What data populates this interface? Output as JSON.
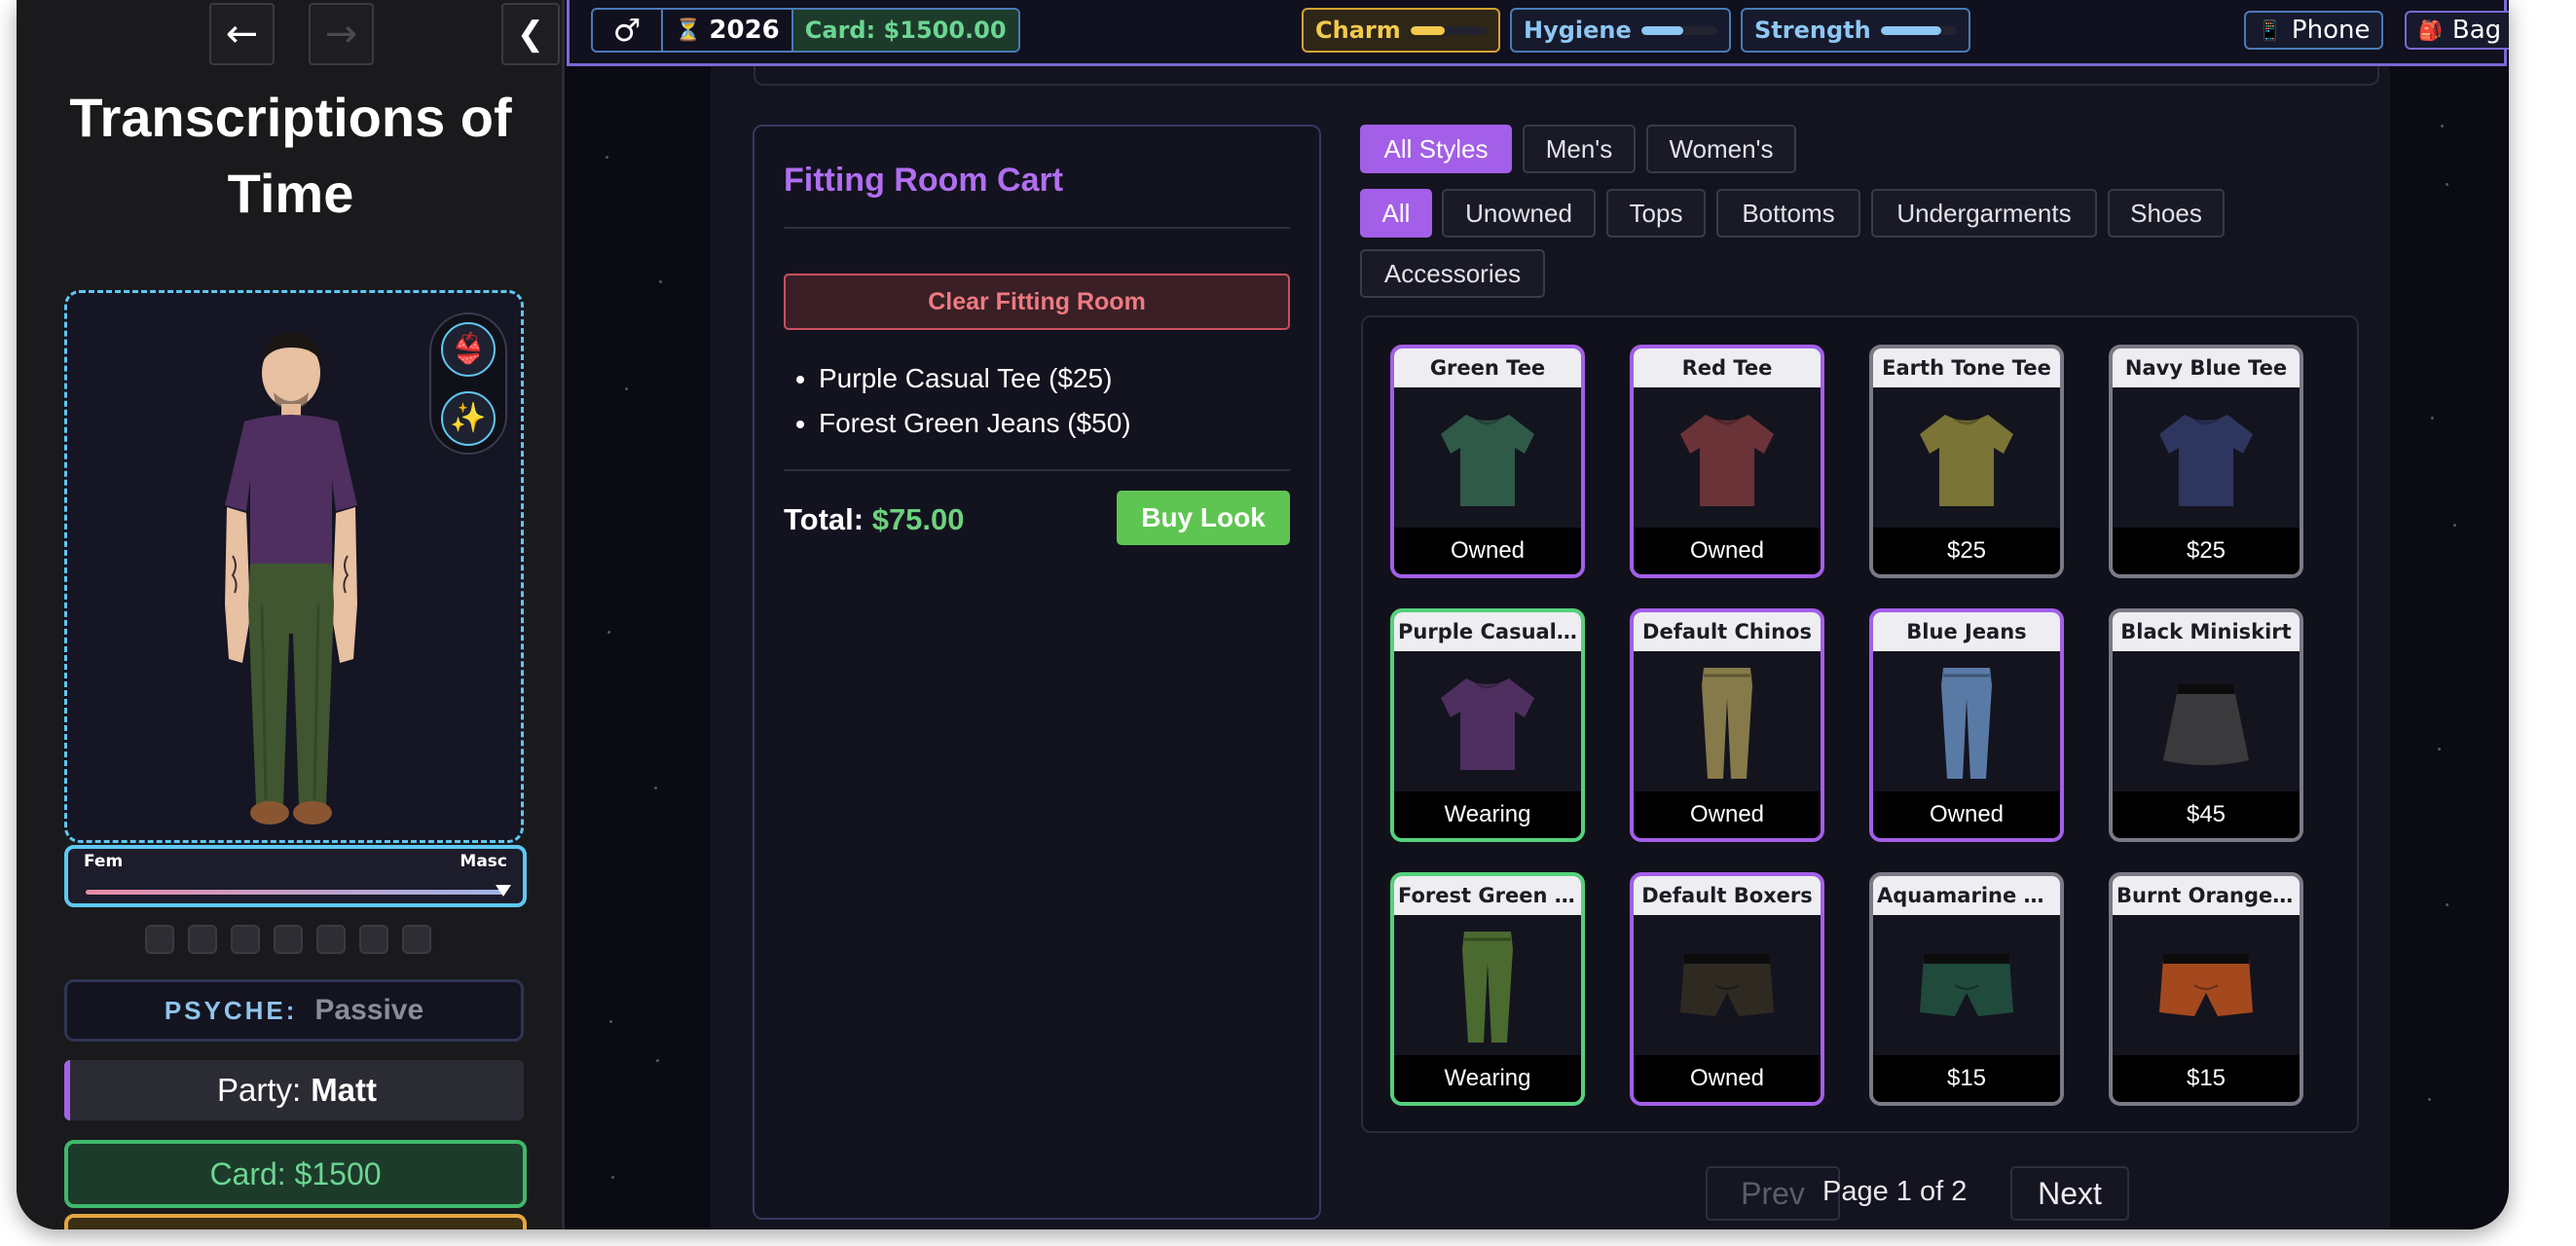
{
  "sidebar": {
    "back_icon": "arrow-left-icon",
    "forward_icon": "arrow-right-icon",
    "collapse_icon": "chevron-left-icon",
    "title": "Transcriptions of Time",
    "tool_buttons": [
      {
        "name": "lingerie-icon",
        "glyph": "👙"
      },
      {
        "name": "sparkles-icon",
        "glyph": "✨"
      }
    ],
    "gender_slider": {
      "left_label": "Fem",
      "right_label": "Masc",
      "value_fraction": 0.97
    },
    "psyche": {
      "label": "PSYCHE:",
      "value": "Passive"
    },
    "party": {
      "label": "Party:",
      "value": "Matt"
    },
    "card": "Card: $1500"
  },
  "topbar": {
    "gender_glyph": "♂",
    "hourglass_glyph": "⏳",
    "year": "2026",
    "card": "Card: $1500.00",
    "stats": [
      {
        "label": "Charm",
        "level": 0.45,
        "color": "#f2c94c",
        "border": "#d4a236",
        "bg": "#2e2616"
      },
      {
        "label": "Hygiene",
        "level": 0.55,
        "color": "#8ec6f4",
        "border": "#4a7ab8",
        "bg": "#161a2c"
      },
      {
        "label": "Strength",
        "level": 0.8,
        "color": "#8ec6f4",
        "border": "#4a7ab8",
        "bg": "#161a2c"
      }
    ],
    "phone_glyph": "📱",
    "phone": "Phone",
    "bag_glyph": "🎒",
    "bag": "Bag"
  },
  "cart": {
    "title": "Fitting Room Cart",
    "clear_label": "Clear Fitting Room",
    "items": [
      "Purple Casual Tee ($25)",
      "Forest Green Jeans ($50)"
    ],
    "total_label": "Total:",
    "total_value": "$75.00",
    "buy_label": "Buy Look"
  },
  "filters": {
    "styles": [
      "All Styles",
      "Men's",
      "Women's"
    ],
    "active_style": "All Styles",
    "categories": [
      "All",
      "Unowned",
      "Tops",
      "Bottoms",
      "Undergarments",
      "Shoes",
      "Accessories"
    ],
    "active_category": "All"
  },
  "items": [
    {
      "name": "Green Tee",
      "status": "Owned",
      "state": "owned",
      "kind": "tee",
      "color": "#2f5a48"
    },
    {
      "name": "Red Tee",
      "status": "Owned",
      "state": "owned",
      "kind": "tee",
      "color": "#6a3338"
    },
    {
      "name": "Earth Tone Tee",
      "status": "$25",
      "state": "forsale",
      "kind": "tee",
      "color": "#7a7436"
    },
    {
      "name": "Navy Blue Tee",
      "status": "$25",
      "state": "forsale",
      "kind": "tee",
      "color": "#2e3660"
    },
    {
      "name": "Purple Casual Tee",
      "status": "Wearing",
      "state": "wearing",
      "kind": "tee",
      "color": "#4e2f60"
    },
    {
      "name": "Default Chinos",
      "status": "Owned",
      "state": "owned",
      "kind": "pants",
      "color": "#867a4a"
    },
    {
      "name": "Blue Jeans",
      "status": "Owned",
      "state": "owned",
      "kind": "pants",
      "color": "#5a7aa6"
    },
    {
      "name": "Black Miniskirt",
      "status": "$45",
      "state": "forsale",
      "kind": "skirt",
      "color": "#3a3a3c"
    },
    {
      "name": "Forest Green Jeans",
      "status": "Wearing",
      "state": "wearing",
      "kind": "pants",
      "color": "#4a6a30"
    },
    {
      "name": "Default Boxers",
      "status": "Owned",
      "state": "owned",
      "kind": "boxers",
      "color": "#2e2a22"
    },
    {
      "name": "Aquamarine Boxers",
      "status": "$15",
      "state": "forsale",
      "kind": "boxers",
      "color": "#1f4a3c"
    },
    {
      "name": "Burnt Orange Boxers",
      "status": "$15",
      "state": "forsale",
      "kind": "boxers",
      "color": "#a4481e"
    }
  ],
  "pager": {
    "prev": "Prev",
    "text": "Page 1 of 2",
    "next": "Next"
  }
}
